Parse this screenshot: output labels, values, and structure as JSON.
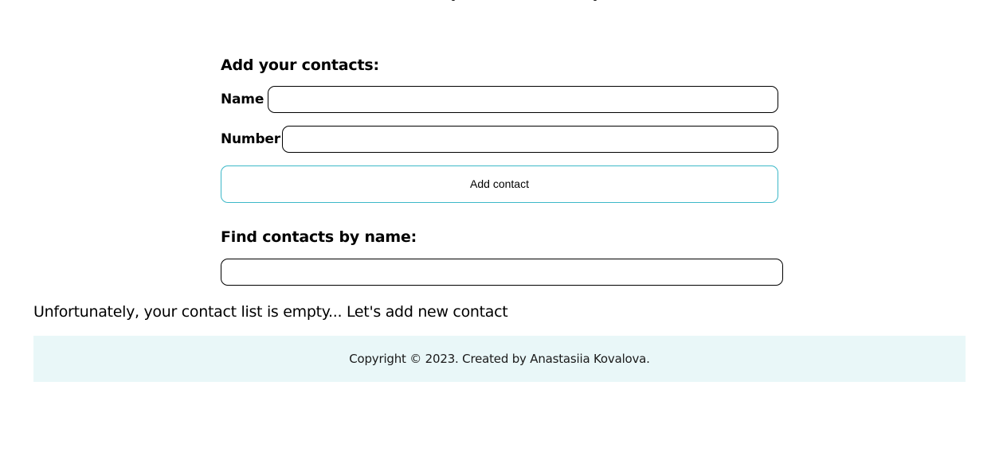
{
  "add_section": {
    "title": "Add your contacts:",
    "name_label": "Name",
    "name_value": "",
    "number_label": "Number",
    "number_value": "",
    "add_button_label": "Add contact"
  },
  "find_section": {
    "title": "Find contacts by name:",
    "search_value": ""
  },
  "empty_message": "Unfortunately, your contact list is empty... Let's add new contact",
  "footer": {
    "copyright": "Copyright © 2023. Created by Anastasiia Kovalova."
  },
  "colors": {
    "button_border": "#3cb8c8",
    "footer_background": "#e9f7f8",
    "input_border": "#000000"
  }
}
